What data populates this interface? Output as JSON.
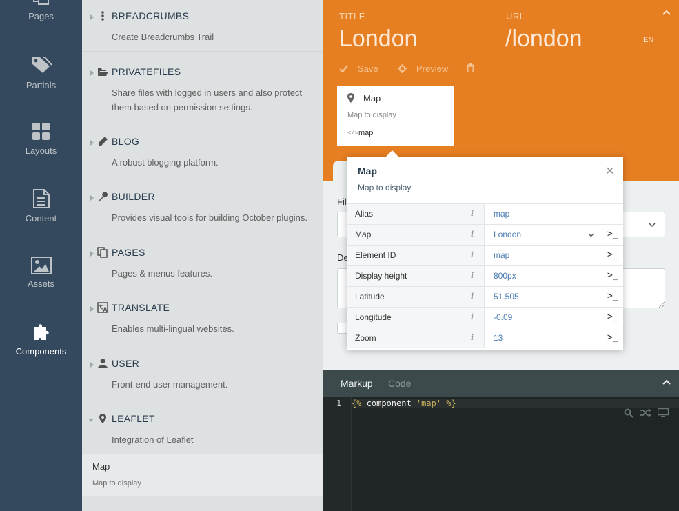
{
  "nav": {
    "items": [
      {
        "label": "Pages"
      },
      {
        "label": "Partials"
      },
      {
        "label": "Layouts"
      },
      {
        "label": "Content"
      },
      {
        "label": "Assets"
      },
      {
        "label": "Components"
      }
    ],
    "active": "Components"
  },
  "plugins": [
    {
      "name": "BREADCRUMBS",
      "desc": "Create Breadcrumbs Trail",
      "icon": "dots-vertical-icon"
    },
    {
      "name": "PRIVATEFILES",
      "desc": "Share files with logged in users and also protect them based on permission settings.",
      "icon": "folder-open-icon"
    },
    {
      "name": "BLOG",
      "desc": "A robust blogging platform.",
      "icon": "pencil-icon"
    },
    {
      "name": "BUILDER",
      "desc": "Provides visual tools for building October plugins.",
      "icon": "wrench-icon"
    },
    {
      "name": "PAGES",
      "desc": "Pages & menus features.",
      "icon": "copy-icon"
    },
    {
      "name": "TRANSLATE",
      "desc": "Enables multi-lingual websites.",
      "icon": "translate-icon"
    },
    {
      "name": "USER",
      "desc": "Front-end user management.",
      "icon": "user-icon"
    },
    {
      "name": "LEAFLET",
      "desc": "Integration of Leaflet",
      "icon": "map-marker-icon"
    }
  ],
  "leaflet_component": {
    "name": "Map",
    "desc": "Map to display"
  },
  "editor": {
    "title_label": "TITLE",
    "title_value": "London",
    "url_label": "URL",
    "url_value": "/london",
    "lang": "EN",
    "save_label": "Save",
    "preview_label": "Preview",
    "accent_color": "#e67e22"
  },
  "card": {
    "title": "Map",
    "desc": "Map to display",
    "code_icon": "</>",
    "alias": "map"
  },
  "below": {
    "file_label": "Fil",
    "desc_label": "De"
  },
  "popup": {
    "title": "Map",
    "desc": "Map to display",
    "close": "×",
    "rows": [
      {
        "key": "Alias",
        "value": "map",
        "dropdown": false,
        "term": ""
      },
      {
        "key": "Map",
        "value": "London",
        "dropdown": true,
        "term": ">_"
      },
      {
        "key": "Element ID",
        "value": "map",
        "dropdown": false,
        "term": ">_"
      },
      {
        "key": "Display height",
        "value": "800px",
        "dropdown": false,
        "term": ">_"
      },
      {
        "key": "Latitude",
        "value": "51.505",
        "dropdown": false,
        "term": ">_"
      },
      {
        "key": "Longitude",
        "value": "-0.09",
        "dropdown": false,
        "term": ">_"
      },
      {
        "key": "Zoom",
        "value": "13",
        "dropdown": false,
        "term": ">_"
      }
    ]
  },
  "code": {
    "tabs": [
      "Markup",
      "Code"
    ],
    "active_tab": "Markup",
    "line_number": "1",
    "line_open": "{%",
    "line_keyword": " component ",
    "line_string": "'map'",
    "line_close": " %}"
  }
}
